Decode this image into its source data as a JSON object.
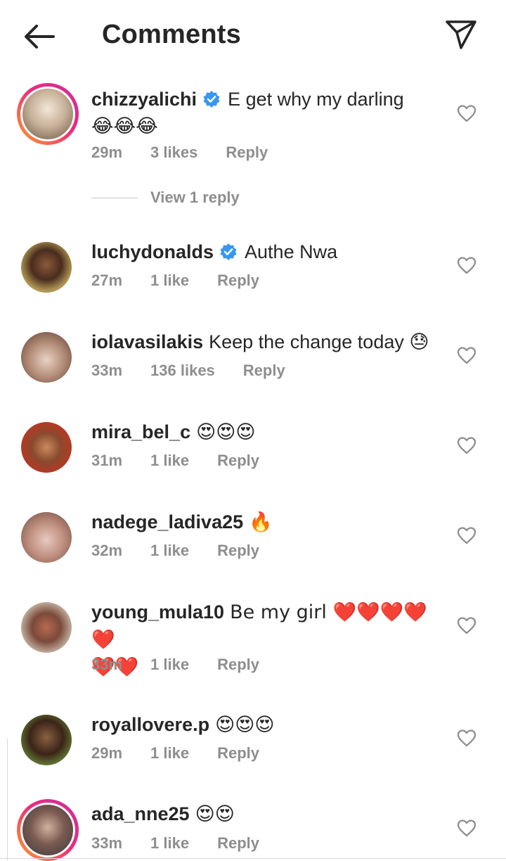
{
  "header": {
    "title": "Comments",
    "back_icon": "arrow-left-icon",
    "share_icon": "send-paper-plane-icon"
  },
  "comments": [
    {
      "username": "chizzyalichi",
      "verified": true,
      "text": "E get why my darling",
      "text2": "😂😂😂",
      "time": "29m",
      "likes": "3 likes",
      "reply": "Reply",
      "story": true
    },
    {
      "username": "luchydonalds",
      "verified": true,
      "text": "Authe Nwa",
      "time": "27m",
      "likes": "1 like",
      "reply": "Reply",
      "story": false
    },
    {
      "username": "iolavasilakis",
      "verified": false,
      "text": "Keep the change today 😓",
      "time": "33m",
      "likes": "136 likes",
      "reply": "Reply",
      "story": false
    },
    {
      "username": "mira_bel_c",
      "verified": false,
      "text": "😍😍😍",
      "time": "31m",
      "likes": "1 like",
      "reply": "Reply",
      "story": false
    },
    {
      "username": "nadege_ladiva25",
      "verified": false,
      "text": "🔥",
      "time": "32m",
      "likes": "1 like",
      "reply": "Reply",
      "story": false
    },
    {
      "username": "young_mula10",
      "verified": false,
      "text": "Be my girl ❤️❤️❤️❤️❤️",
      "text2": "❤️❤️",
      "time": "33m",
      "likes": "1 like",
      "reply": "Reply",
      "story": false
    },
    {
      "username": "royallovere.p",
      "verified": false,
      "text": "😍😍😍",
      "time": "29m",
      "likes": "1 like",
      "reply": "Reply",
      "story": false
    },
    {
      "username": "ada_nne25",
      "verified": false,
      "text": "😍😍",
      "time": "33m",
      "likes": "1 like",
      "reply": "Reply",
      "story": true
    }
  ],
  "view_replies": "View 1 reply",
  "colors": {
    "verified": "#3897f0",
    "meta_gray": "#8e8e8e",
    "story_ring_start": "#f9a22a",
    "story_ring_end": "#cc2f9c"
  }
}
